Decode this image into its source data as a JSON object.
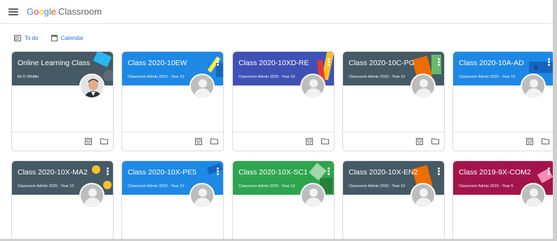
{
  "app": {
    "logo_google": "Google",
    "logo_product": "Classroom"
  },
  "toolbar": {
    "todo_label": "To do",
    "calendar_label": "Calendar"
  },
  "colors": {
    "teal": "#455a64",
    "blue": "#1e88e5",
    "indigo": "#3f51b5",
    "green": "#2ea44f",
    "magenta": "#a3154a",
    "accent_link": "#1a73e8"
  },
  "classes": [
    {
      "name": "Online Learning Class",
      "teacher": "Mr D Whittle"
    },
    {
      "name": "Class 2020-10EW",
      "teacher": "Classroom Admin 2020 - Year 10"
    },
    {
      "name": "Class 2020-10XD-RE",
      "teacher": "Classroom Admin 2020 - Year 10"
    },
    {
      "name": "Class 2020-10C-PG",
      "teacher": "Classroom Admin 2020 - Year 10"
    },
    {
      "name": "Class 2020-10A-AD",
      "teacher": "Classroom Admin 2020 - Year 10"
    },
    {
      "name": "Class 2020-10X-MA2",
      "teacher": "Classroom Admin 2020 - Year 10"
    },
    {
      "name": "Class 2020-10X-PE5",
      "teacher": "Classroom Admin 2020 - Year 10"
    },
    {
      "name": "Class 2020-10X-SC1",
      "teacher": "Classroom Admin 2020 - Year 10"
    },
    {
      "name": "Class 2020-10X-EN2",
      "teacher": "Classroom Admin 2020 - Year 10"
    },
    {
      "name": "Class 2019-9X-COM2",
      "teacher": "Classroom Admin 2019 - Year 9"
    }
  ]
}
